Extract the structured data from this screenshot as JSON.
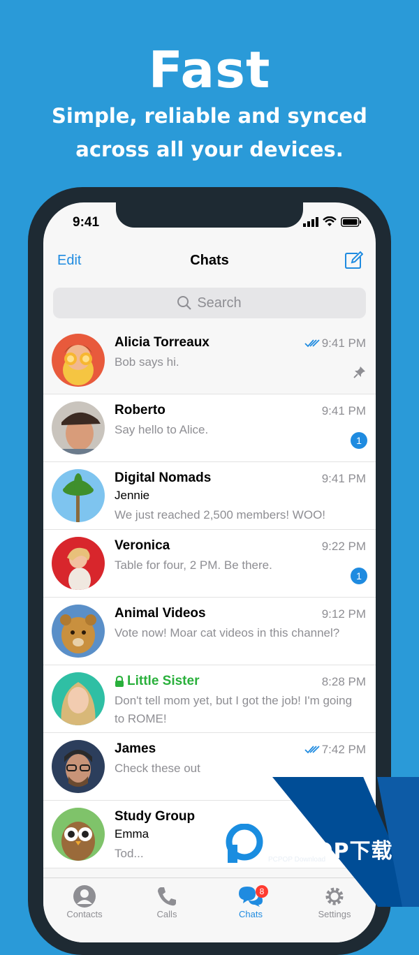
{
  "promo": {
    "title": "Fast",
    "subtitle_line1": "Simple, reliable and synced",
    "subtitle_line2": "across all your devices."
  },
  "status_bar": {
    "time": "9:41"
  },
  "nav": {
    "edit_label": "Edit",
    "title": "Chats"
  },
  "search": {
    "placeholder": "Search"
  },
  "chats": [
    {
      "name": "Alicia Torreaux",
      "time": "9:41 PM",
      "message": "Bob says hi.",
      "read": true,
      "pinned": true
    },
    {
      "name": "Roberto",
      "time": "9:41 PM",
      "message": "Say hello to Alice.",
      "unread": "1"
    },
    {
      "name": "Digital Nomads",
      "time": "9:41 PM",
      "sender": "Jennie",
      "message": "We just reached 2,500 members! WOO!"
    },
    {
      "name": "Veronica",
      "time": "9:22 PM",
      "message": "Table for four, 2 PM. Be there.",
      "unread": "1"
    },
    {
      "name": "Animal Videos",
      "time": "9:12 PM",
      "message": "Vote now! Moar cat videos in this channel?"
    },
    {
      "name": "Little Sister",
      "time": "8:28 PM",
      "message": "Don't tell mom yet, but I got the job! I'm going to ROME!",
      "secret": true
    },
    {
      "name": "James",
      "time": "7:42 PM",
      "message": "Check these out",
      "read": true
    },
    {
      "name": "Study Group",
      "sender": "Emma",
      "message": "Tod..."
    }
  ],
  "tabs": [
    {
      "label": "Contacts",
      "icon": "person-circle-icon"
    },
    {
      "label": "Calls",
      "icon": "phone-icon"
    },
    {
      "label": "Chats",
      "icon": "chat-bubbles-icon",
      "badge": "8",
      "active": true
    },
    {
      "label": "Settings",
      "icon": "gear-icon"
    }
  ],
  "watermark": {
    "brand": "PCPOP下载",
    "sub": "PCPOP Download"
  },
  "colors": {
    "background": "#2a9ad8",
    "accent": "#1f8be0",
    "secret": "#2ab03c",
    "watermark": "#004d96"
  }
}
